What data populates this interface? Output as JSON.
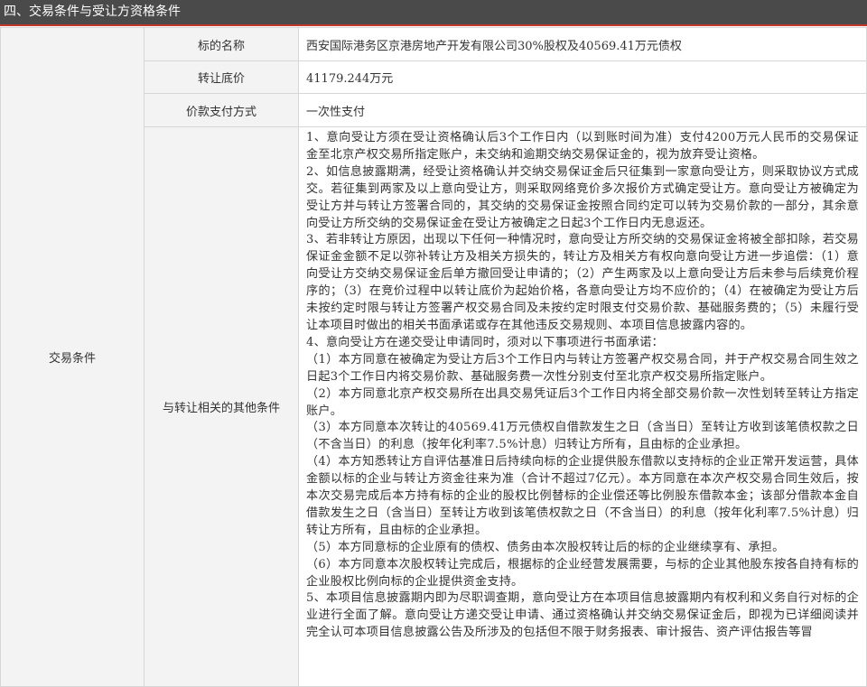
{
  "section": {
    "title": "四、交易条件与受让方资格条件"
  },
  "group_label": "交易条件",
  "rows": [
    {
      "label": "标的名称",
      "value": "西安国际港务区京港房地产开发有限公司30%股权及40569.41万元债权"
    },
    {
      "label": "转让底价",
      "value": "41179.244万元"
    },
    {
      "label": "价款支付方式",
      "value": "一次性支付"
    }
  ],
  "other_conditions": {
    "label": "与转让相关的其他条件",
    "paragraphs": [
      "1、意向受让方须在受让资格确认后3个工作日内（以到账时间为准）支付4200万元人民币的交易保证金至北京产权交易所指定账户，未交纳和逾期交纳交易保证金的，视为放弃受让资格。",
      "2、如信息披露期满，经受让资格确认并交纳交易保证金后只征集到一家意向受让方，则采取协议方式成交。若征集到两家及以上意向受让方，则采取网络竞价多次报价方式确定受让方。意向受让方被确定为受让方并与转让方签署合同的，其交纳的交易保证金按照合同约定可以转为交易价款的一部分，其余意向受让方所交纳的交易保证金在受让方被确定之日起3个工作日内无息返还。",
      "3、若非转让方原因，出现以下任何一种情况时，意向受让方所交纳的交易保证金将被全部扣除，若交易保证金金额不足以弥补转让方及相关方损失的，转让方及相关方有权向意向受让方进一步追偿：（1）意向受让方交纳交易保证金后单方撤回受让申请的；（2）产生两家及以上意向受让方后未参与后续竞价程序的；（3）在竞价过程中以转让底价为起始价格，各意向受让方均不应价的；（4）在被确定为受让方后未按约定时限与转让方签署产权交易合同及未按约定时限支付交易价款、基础服务费的；（5）未履行受让本项目时做出的相关书面承诺或存在其他违反交易规则、本项目信息披露内容的。",
      "4、意向受让方在递交受让申请同时，须对以下事项进行书面承诺：",
      "（1）本方同意在被确定为受让方后3个工作日内与转让方签署产权交易合同，并于产权交易合同生效之日起3个工作日内将交易价款、基础服务费一次性分别支付至北京产权交易所指定账户。",
      "（2）本方同意北京产权交易所在出具交易凭证后3个工作日内将全部交易价款一次性划转至转让方指定账户。",
      "（3）本方同意本次转让的40569.41万元债权自借款发生之日（含当日）至转让方收到该笔债权款之日（不含当日）的利息（按年化利率7.5%计息）归转让方所有，且由标的企业承担。",
      "（4）本方知悉转让方自评估基准日后持续向标的企业提供股东借款以支持标的企业正常开发运营，具体金额以标的企业与转让方资金往来为准（合计不超过7亿元）。本方同意在本次产权交易合同生效后，按本次交易完成后本方持有标的企业的股权比例替标的企业偿还等比例股东借款本金；该部分借款本金自借款发生之日（含当日）至转让方收到该笔债权款之日（不含当日）的利息（按年化利率7.5%计息）归转让方所有，且由标的企业承担。",
      "（5）本方同意标的企业原有的债权、债务由本次股权转让后的标的企业继续享有、承担。",
      "（6）本方同意本次股权转让完成后，根据标的企业经营发展需要，与标的企业其他股东按各自持有标的企业股权比例向标的企业提供资金支持。",
      "5、本项目信息披露期内即为尽职调查期，意向受让方在本项目信息披露期内有权利和义务自行对标的企业进行全面了解。意向受让方递交受让申请、通过资格确认并交纳交易保证金后，即视为已详细阅读并完全认可本项目信息披露公告及所涉及的包括但不限于财务报表、审计报告、资产评估报告等冒"
    ]
  }
}
